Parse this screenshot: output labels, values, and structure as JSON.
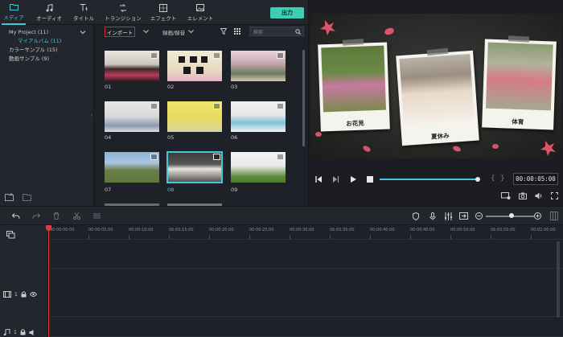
{
  "menu": {
    "tabs": [
      {
        "label": "メディア",
        "icon": "folder-icon"
      },
      {
        "label": "オーディオ",
        "icon": "music-note-icon"
      },
      {
        "label": "タイトル",
        "icon": "title-text-icon"
      },
      {
        "label": "トランジション",
        "icon": "transition-icon"
      },
      {
        "label": "エフェクト",
        "icon": "effects-icon"
      },
      {
        "label": "エレメント",
        "icon": "element-image-icon"
      }
    ],
    "export_label": "出力"
  },
  "project": {
    "root": "My Project (11)",
    "items": [
      "マイアルバム (11)",
      "カラーサンプル (15)",
      "動画サンプル (9)"
    ]
  },
  "media": {
    "import_label": "インポート",
    "sort_label": "録画/録音",
    "search_placeholder": "検索",
    "thumbs": [
      "01",
      "02",
      "03",
      "04",
      "05",
      "06",
      "07",
      "08",
      "09"
    ],
    "selected_index": 7
  },
  "preview": {
    "captions": [
      "お花見",
      "夏休み",
      "体育"
    ],
    "timecode": "00:00:05:00",
    "progress": 0.97
  },
  "timeline": {
    "ruler": [
      "00:00:00:00",
      "00:00:05:00",
      "00:00:10:00",
      "00:00:15:00",
      "00:00:20:00",
      "00:00:25:00",
      "00:00:30:00",
      "00:00:35:00",
      "00:00:40:00",
      "00:00:45:00",
      "00:00:50:00",
      "00:00:55:00",
      "00:01:00:00"
    ],
    "video_track": "1",
    "audio_track": "1"
  },
  "colors": {
    "accent": "#44c8d8",
    "export": "#3ccfb4",
    "import_border": "#d92626",
    "playhead": "#e23a3a"
  }
}
